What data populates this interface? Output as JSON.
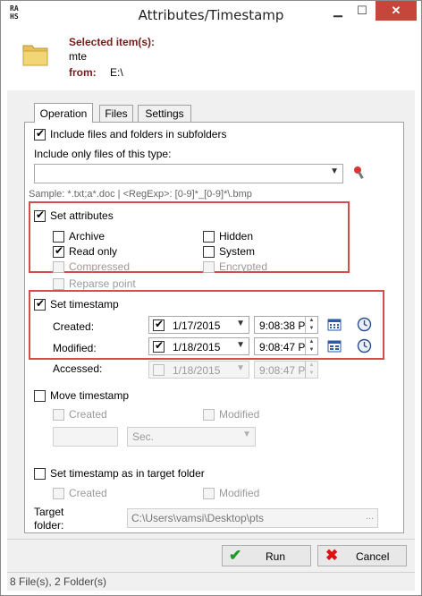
{
  "window": {
    "title": "Attributes/Timestamp",
    "app_icon_text": "RA HS"
  },
  "header": {
    "selected_label": "Selected item(s):",
    "selected_value": "mte",
    "from_label": "from:",
    "from_value": "E:\\"
  },
  "tabs": [
    {
      "label": "Operation",
      "active": true
    },
    {
      "label": "Files",
      "active": false
    },
    {
      "label": "Settings",
      "active": false
    }
  ],
  "operation": {
    "include_subfolders": {
      "label": "Include files and folders in subfolders",
      "checked": true
    },
    "filter_label": "Include only files of this type:",
    "filter_value": "",
    "sample_text": "Sample: *.txt;a*.doc | <RegExp>: [0-9]*_[0-9]*\\.bmp",
    "set_attributes": {
      "label": "Set attributes",
      "checked": true,
      "archive": {
        "label": "Archive",
        "checked": false
      },
      "hidden": {
        "label": "Hidden",
        "checked": false
      },
      "read_only": {
        "label": "Read only",
        "checked": true
      },
      "system": {
        "label": "System",
        "checked": false
      },
      "compressed": {
        "label": "Compressed",
        "checked": false
      },
      "encrypted": {
        "label": "Encrypted",
        "checked": false
      },
      "reparse": {
        "label": "Reparse point",
        "checked": false
      }
    },
    "set_timestamp": {
      "label": "Set timestamp",
      "checked": true,
      "created": {
        "label": "Created:",
        "date": "1/17/2015",
        "time": "9:08:38 P",
        "checked": true
      },
      "modified": {
        "label": "Modified:",
        "date": "1/18/2015",
        "time": "9:08:47 P",
        "checked": true
      },
      "accessed": {
        "label": "Accessed:",
        "date": "1/18/2015",
        "time": "9:08:47 P",
        "checked": false
      }
    },
    "move_timestamp": {
      "label": "Move timestamp",
      "checked": false,
      "created": "Created",
      "modified": "Modified",
      "unit": "Sec."
    },
    "target_folder_ts": {
      "label": "Set timestamp as in target folder",
      "checked": false,
      "created": "Created",
      "modified": "Modified",
      "target_label": "Target folder:",
      "target_value": "C:\\Users\\vamsi\\Desktop\\pts",
      "browse": "..."
    }
  },
  "buttons": {
    "run": "Run",
    "cancel": "Cancel"
  },
  "status": {
    "text": "8 File(s), 2 Folder(s)"
  },
  "colors": {
    "highlight": "#d74b4b",
    "close": "#c7463b",
    "label_red": "#7a1a1a"
  }
}
